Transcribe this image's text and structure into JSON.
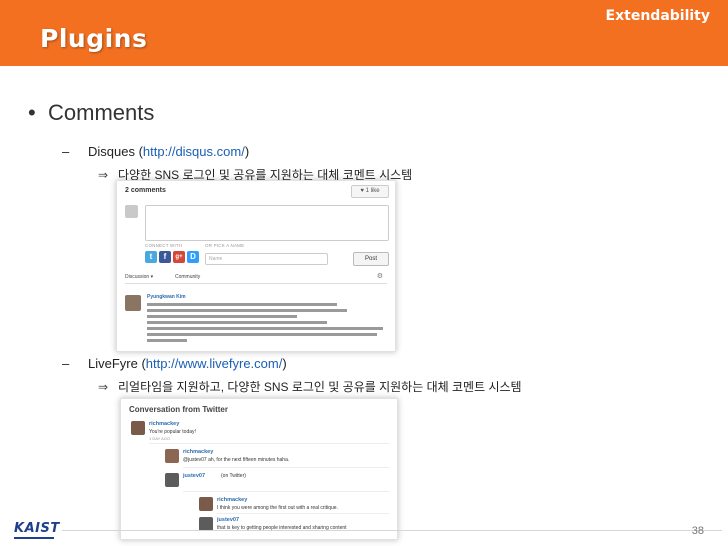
{
  "header": {
    "title": "Plugins",
    "tag": "Extendability",
    "color": "#f37021"
  },
  "bullet": {
    "symbol": "•",
    "label": "Comments"
  },
  "items": [
    {
      "dash": "–",
      "name": "Disques (",
      "url": "http://disqus.com/",
      "close": ")",
      "arrow": "⇒",
      "description": "다양한 SNS 로그인 및 공유를 지원하는 대체 코멘트 시스템"
    },
    {
      "dash": "–",
      "name": "LiveFyre (",
      "url": "http://www.livefyre.com/",
      "close": ")",
      "arrow": "⇒",
      "description": "리얼타임을 지원하고, 다양한 SNS 로그인 및 공유를 지원하는 대체 코멘트 시스템"
    }
  ],
  "disqus_shot": {
    "count": "2 comments",
    "like": "♥ 1 like",
    "connect_label": "CONNECT WITH",
    "pick_label": "OR PICK A NAME",
    "social": [
      "t",
      "f",
      "g+",
      "D"
    ],
    "name_placeholder": "Name",
    "post_label": "Post",
    "tab_discussion": "Discussion ▾",
    "tab_community": "Community",
    "gear": "⚙",
    "commenter": "Pyungkwan Kim"
  },
  "livefyre_shot": {
    "title": "Conversation from Twitter",
    "comments": [
      {
        "name": "richmackey",
        "text": "You're popular today!"
      },
      {
        "name": "richmackey",
        "text": "@justev07 ah, for the next fifteen minutes haha."
      },
      {
        "name": "justev07",
        "text": "(on Twitter)"
      },
      {
        "name": "richmackey",
        "text": "I think you were among the first out with a real critique."
      },
      {
        "name": "justev07",
        "text": "that is key to getting people interested and sharing content"
      }
    ],
    "meta": "1 DAY AGO"
  },
  "footer": {
    "logo": "KAIST",
    "page": "38"
  }
}
